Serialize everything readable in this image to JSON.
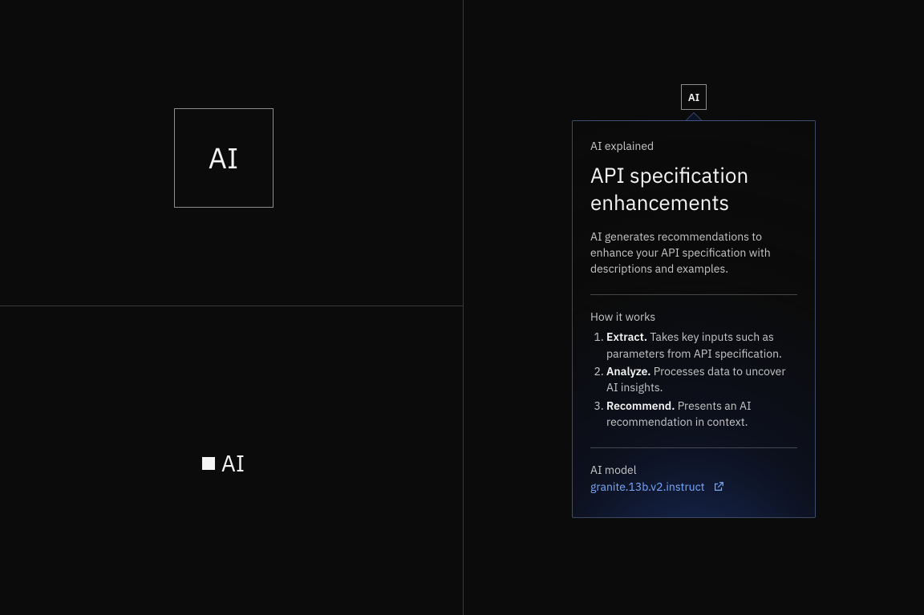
{
  "left": {
    "ai_box_label": "AI",
    "ai_inline_label": "AI"
  },
  "chip": {
    "label": "AI"
  },
  "popover": {
    "eyebrow": "AI explained",
    "title": "API specification enhancements",
    "description": "AI generates recommendations to enhance your API specification with descriptions and examples.",
    "how_label": "How it works",
    "steps": [
      {
        "title": "Extract.",
        "body": "Takes key inputs such as parameters from API specification."
      },
      {
        "title": "Analyze.",
        "body": "Processes data to uncover AI insights."
      },
      {
        "title": "Recommend.",
        "body": "Presents an AI recommendation in context."
      }
    ],
    "model_label": "AI model",
    "model_link_text": "granite.13b.v2.instruct"
  }
}
